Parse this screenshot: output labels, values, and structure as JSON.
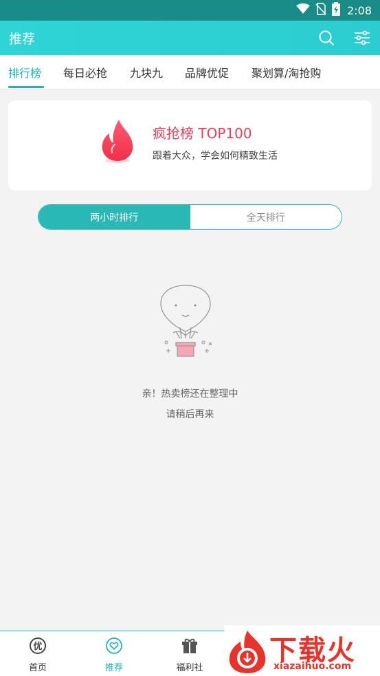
{
  "status_bar": {
    "time": "2:08",
    "icons": [
      "wifi-icon",
      "no-sim-icon",
      "battery-charging-icon"
    ]
  },
  "app_bar": {
    "title": "推荐",
    "actions": [
      "search-icon",
      "filter-sliders-icon"
    ]
  },
  "tabs": [
    {
      "label": "排行榜",
      "active": true
    },
    {
      "label": "每日必抢",
      "active": false
    },
    {
      "label": "九块九",
      "active": false
    },
    {
      "label": "品牌优促",
      "active": false
    },
    {
      "label": "聚划算/淘抢购",
      "active": false
    }
  ],
  "banner": {
    "title": "疯抢榜 TOP100",
    "subtitle": "跟着大众，学会如何精致生活",
    "icon": "flame-icon"
  },
  "segment": {
    "options": [
      "两小时排行",
      "全天排行"
    ],
    "selected": "两小时排行"
  },
  "empty_state": {
    "line1": "亲！热卖榜还在整理中",
    "line2": "请稍后再来",
    "icon": "hot-air-balloon-icon"
  },
  "bottom_nav": [
    {
      "label": "首页",
      "icon": "you-badge-icon",
      "active": false
    },
    {
      "label": "推荐",
      "icon": "heart-circle-icon",
      "active": true
    },
    {
      "label": "福利社",
      "icon": "gift-icon",
      "active": false
    }
  ],
  "watermark": {
    "text": "下载火",
    "url": "xiazaihuo.com"
  },
  "colors": {
    "accent": "#1fb3b1",
    "app_bar": "#2fd4d6",
    "status_bar": "#1a8c88",
    "banner_title": "#e6405a",
    "watermark": "#e8332a"
  }
}
